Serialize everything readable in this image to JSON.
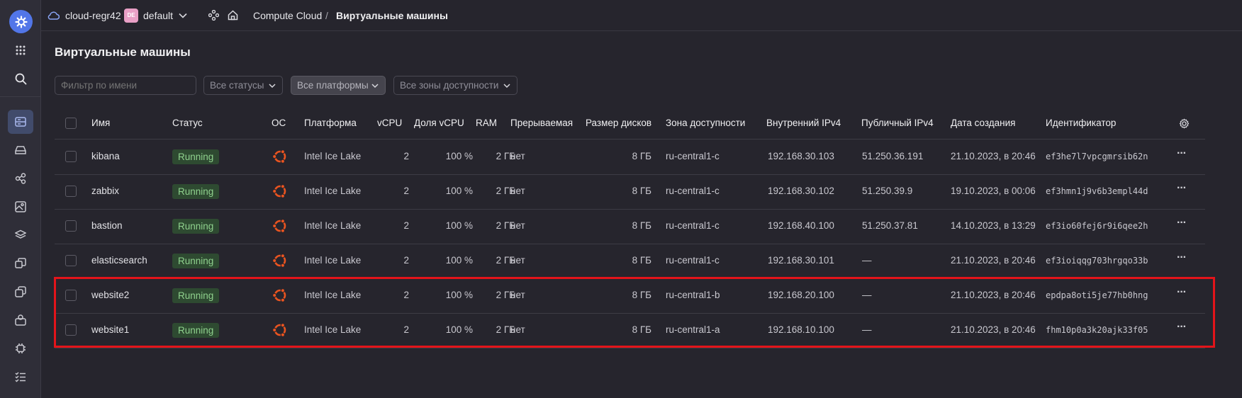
{
  "header": {
    "cloud": "cloud-regr42",
    "folder_badge": "DE",
    "folder": "default",
    "breadcrumb_service": "Compute Cloud",
    "breadcrumb_sep": "/",
    "breadcrumb_page": "Виртуальные машины"
  },
  "page": {
    "title": "Виртуальные машины"
  },
  "filters": {
    "name_placeholder": "Фильтр по имени",
    "statuses": "Все статусы",
    "platforms": "Все платформы",
    "zones": "Все зоны доступности"
  },
  "table": {
    "headers": {
      "name": "Имя",
      "status": "Статус",
      "os": "ОС",
      "platform": "Платформа",
      "vcpu": "vCPU",
      "vcpu_share": "Доля vCPU",
      "ram": "RAM",
      "preemptible": "Прерываемая",
      "disk": "Размер дисков",
      "zone": "Зона доступности",
      "ipv4_int": "Внутренний IPv4",
      "ipv4_pub": "Публичный IPv4",
      "created": "Дата создания",
      "id": "Идентификатор"
    },
    "rows": [
      {
        "name": "kibana",
        "status": "Running",
        "platform": "Intel Ice Lake",
        "vcpu": "2",
        "share": "100 %",
        "ram": "2 ГБ",
        "preemptible": "нет",
        "disk": "8 ГБ",
        "zone": "ru-central1-c",
        "ip_int": "192.168.30.103",
        "ip_pub": "51.250.36.191",
        "created": "21.10.2023, в 20:46",
        "id": "ef3he7l7vpcgmrsib62n"
      },
      {
        "name": "zabbix",
        "status": "Running",
        "platform": "Intel Ice Lake",
        "vcpu": "2",
        "share": "100 %",
        "ram": "2 ГБ",
        "preemptible": "нет",
        "disk": "8 ГБ",
        "zone": "ru-central1-c",
        "ip_int": "192.168.30.102",
        "ip_pub": "51.250.39.9",
        "created": "19.10.2023, в 00:06",
        "id": "ef3hmn1j9v6b3empl44d"
      },
      {
        "name": "bastion",
        "status": "Running",
        "platform": "Intel Ice Lake",
        "vcpu": "2",
        "share": "100 %",
        "ram": "2 ГБ",
        "preemptible": "нет",
        "disk": "8 ГБ",
        "zone": "ru-central1-c",
        "ip_int": "192.168.40.100",
        "ip_pub": "51.250.37.81",
        "created": "14.10.2023, в 13:29",
        "id": "ef3io60fej6r9i6qee2h"
      },
      {
        "name": "elasticsearch",
        "status": "Running",
        "platform": "Intel Ice Lake",
        "vcpu": "2",
        "share": "100 %",
        "ram": "2 ГБ",
        "preemptible": "нет",
        "disk": "8 ГБ",
        "zone": "ru-central1-c",
        "ip_int": "192.168.30.101",
        "ip_pub": "—",
        "created": "21.10.2023, в 20:46",
        "id": "ef3ioiqqg703hrgqo33b"
      },
      {
        "name": "website2",
        "status": "Running",
        "platform": "Intel Ice Lake",
        "vcpu": "2",
        "share": "100 %",
        "ram": "2 ГБ",
        "preemptible": "нет",
        "disk": "8 ГБ",
        "zone": "ru-central1-b",
        "ip_int": "192.168.20.100",
        "ip_pub": "—",
        "created": "21.10.2023, в 20:46",
        "id": "epdpa8oti5je77hb0hng"
      },
      {
        "name": "website1",
        "status": "Running",
        "platform": "Intel Ice Lake",
        "vcpu": "2",
        "share": "100 %",
        "ram": "2 ГБ",
        "preemptible": "нет",
        "disk": "8 ГБ",
        "zone": "ru-central1-a",
        "ip_int": "192.168.10.100",
        "ip_pub": "—",
        "created": "21.10.2023, в 20:46",
        "id": "fhm10p0a3k20ajk33f05"
      }
    ]
  },
  "colors": {
    "accent": "#5276e8",
    "status_bg": "#2e4a31",
    "status_text": "#8fd18d",
    "ubuntu": "#e95420",
    "highlight": "#e3141a"
  },
  "icons": [
    "gear-icon",
    "apps-grid-icon",
    "search-icon",
    "server-list-icon",
    "disk-icon",
    "network-icon",
    "image-icon",
    "layers-icon",
    "snapshot-icon",
    "copy-icon",
    "group-icon",
    "cpu-icon",
    "checklist-icon",
    "cloud-icon",
    "chevron-down-icon",
    "services-icon",
    "home-icon",
    "ubuntu-icon",
    "settings-icon",
    "more-icon"
  ]
}
